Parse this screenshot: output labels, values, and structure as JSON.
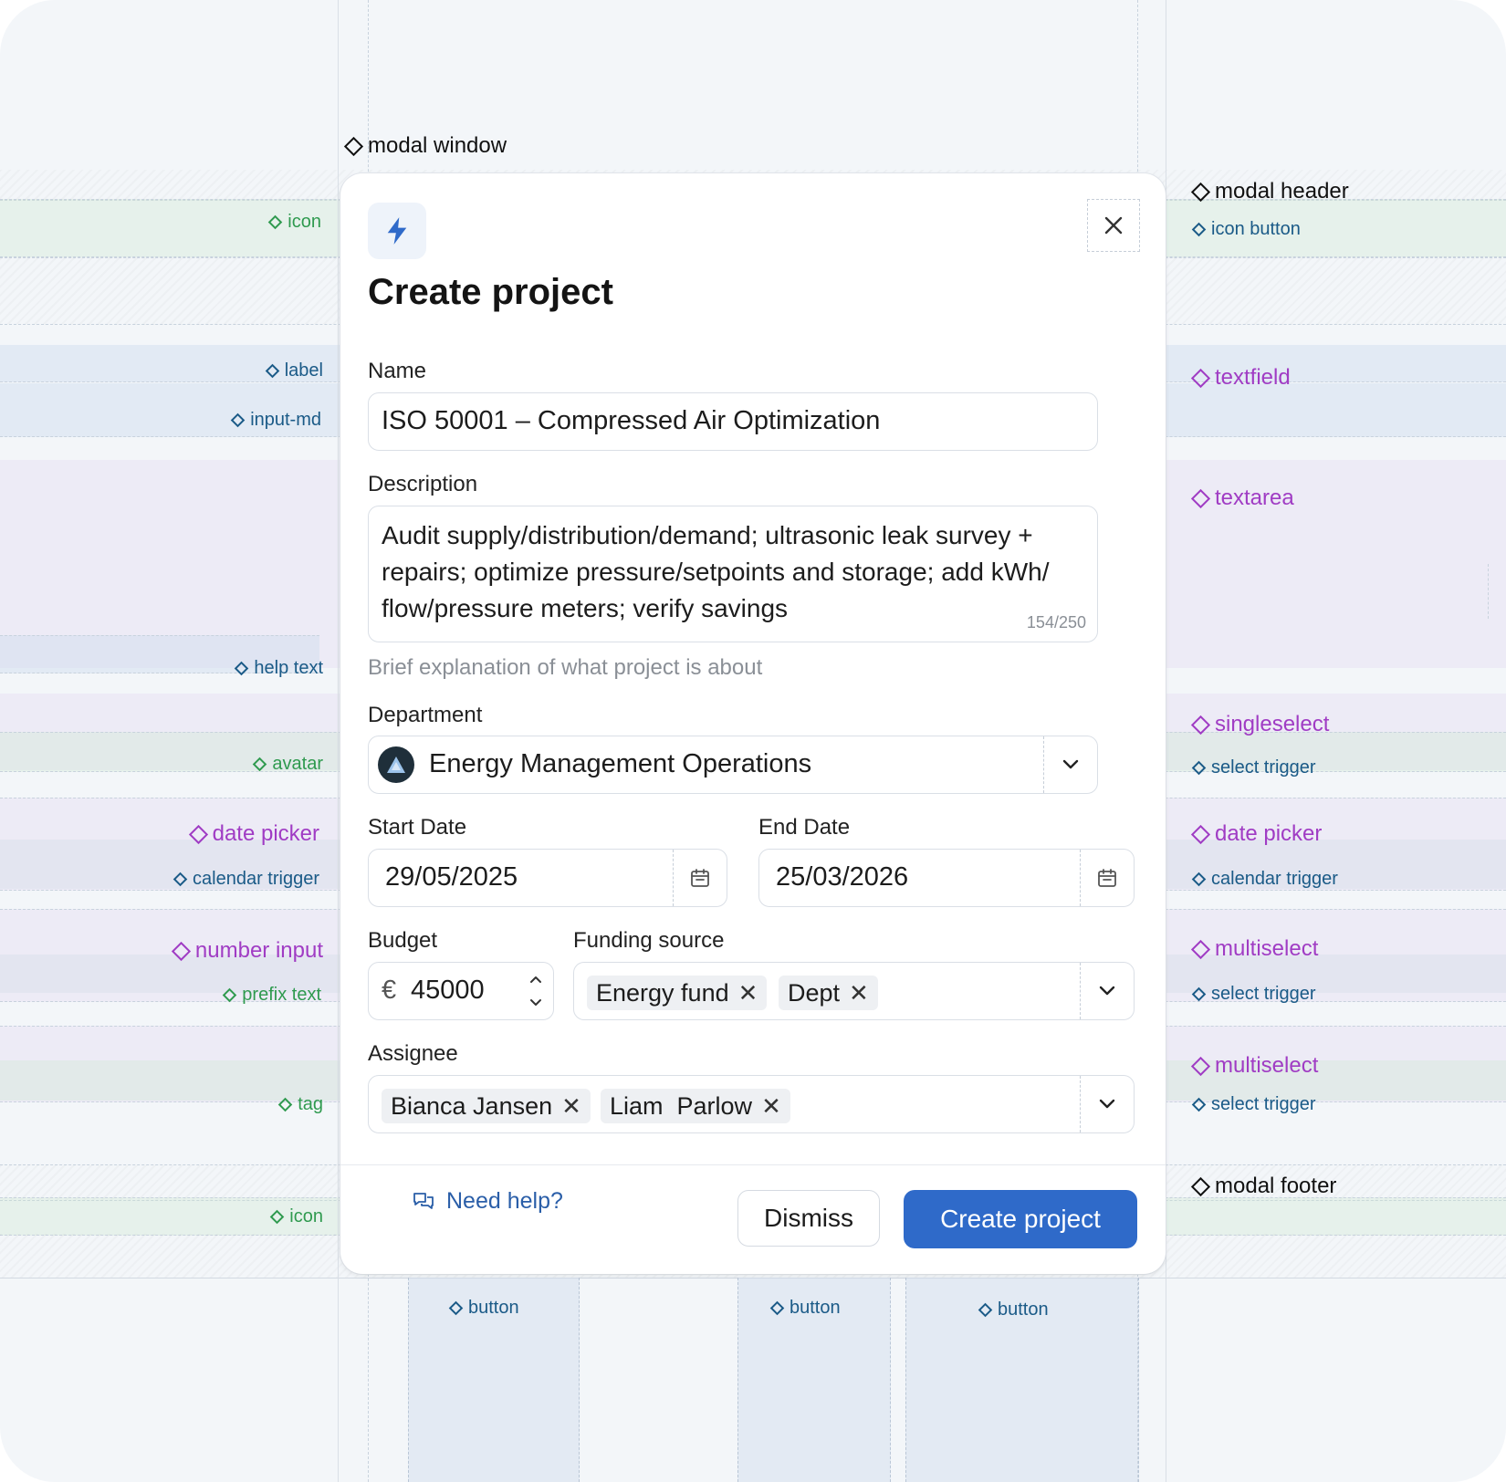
{
  "modal": {
    "title": "Create project",
    "close_icon": "close-icon",
    "header_icon": "lightning-bolt-icon",
    "accent_color": "#2f6ac9",
    "name": {
      "label": "Name",
      "value": "ISO 50001 – Compressed Air Optimization"
    },
    "description": {
      "label": "Description",
      "lines": [
        "Audit supply/distribution/demand; ultrasonic leak survey +",
        "repairs; optimize pressure/setpoints and storage; add kWh/",
        "flow/pressure meters; verify savings"
      ],
      "counter": "154/250",
      "help": "Brief explanation of what project is about"
    },
    "department": {
      "label": "Department",
      "value": "Energy Management Operations"
    },
    "start_date": {
      "label": "Start Date",
      "value": "29/05/2025"
    },
    "end_date": {
      "label": "End Date",
      "value": "25/03/2026"
    },
    "budget": {
      "label": "Budget",
      "prefix": "€",
      "value": "45000"
    },
    "funding": {
      "label": "Funding source",
      "tags": [
        "Energy fund",
        "Dept"
      ]
    },
    "assignee": {
      "label": "Assignee",
      "tags": [
        "Bianca Jansen",
        "Liam  Parlow"
      ]
    },
    "footer": {
      "help_link": "Need help?",
      "dismiss": "Dismiss",
      "create": "Create project"
    }
  },
  "annotations": {
    "modal_window": "modal window",
    "modal_header": "modal header",
    "icon_button": "icon button",
    "textfield": "textfield",
    "textarea": "textarea",
    "singleselect": "singleselect",
    "select_trigger": "select trigger",
    "date_picker": "date picker",
    "calendar_trigger": "calendar trigger",
    "multiselect": "multiselect",
    "modal_footer": "modal footer",
    "icon": "icon",
    "label": "label",
    "input_md": "input-md",
    "help_text": "help text",
    "avatar": "avatar",
    "number_input": "number input",
    "prefix_text": "prefix text",
    "tag": "tag",
    "button": "button"
  }
}
